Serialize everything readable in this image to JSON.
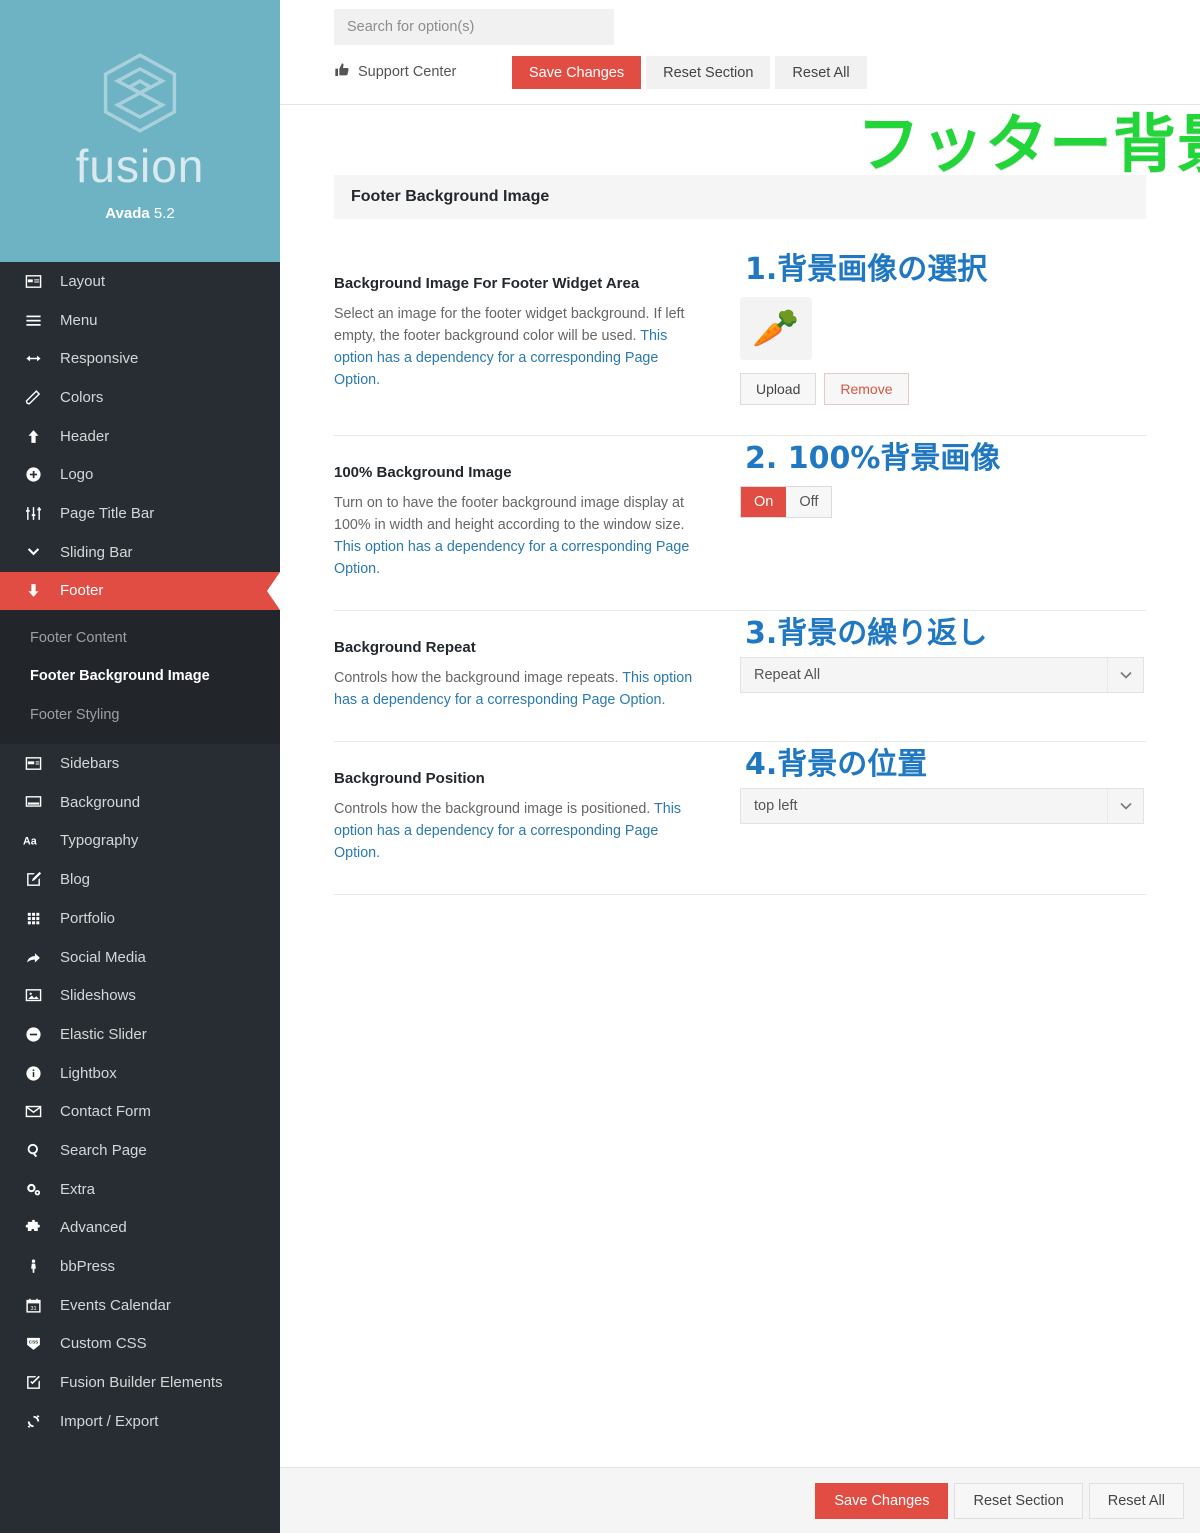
{
  "brand": {
    "logo_icon": "fusion-hex-logo-icon",
    "wordmark": "fusion",
    "product": "Avada",
    "version": "5.2"
  },
  "topbar": {
    "search_placeholder": "Search for option(s)",
    "search_value": "",
    "support_icon": "thumbs-up-icon",
    "support_label": "Support Center",
    "save_label": "Save Changes",
    "reset_section_label": "Reset Section",
    "reset_all_label": "Reset All"
  },
  "sidebar": {
    "items": [
      {
        "label": "Layout",
        "icon": "layout-icon"
      },
      {
        "label": "Menu",
        "icon": "hamburger-menu-icon"
      },
      {
        "label": "Responsive",
        "icon": "arrows-horizontal-icon"
      },
      {
        "label": "Colors",
        "icon": "paint-brush-icon"
      },
      {
        "label": "Header",
        "icon": "arrow-up-icon"
      },
      {
        "label": "Logo",
        "icon": "plus-circle-icon"
      },
      {
        "label": "Page Title Bar",
        "icon": "sliders-icon"
      },
      {
        "label": "Sliding Bar",
        "icon": "chevron-down-icon"
      },
      {
        "label": "Footer",
        "icon": "arrow-down-icon",
        "active": true
      },
      {
        "label": "Sidebars",
        "icon": "sidebars-icon"
      },
      {
        "label": "Background",
        "icon": "background-icon"
      },
      {
        "label": "Typography",
        "icon": "aa-typography-icon"
      },
      {
        "label": "Blog",
        "icon": "pencil-square-icon"
      },
      {
        "label": "Portfolio",
        "icon": "grid-dots-icon"
      },
      {
        "label": "Social Media",
        "icon": "share-arrow-icon"
      },
      {
        "label": "Slideshows",
        "icon": "image-icon"
      },
      {
        "label": "Elastic Slider",
        "icon": "minus-circle-icon"
      },
      {
        "label": "Lightbox",
        "icon": "info-circle-icon"
      },
      {
        "label": "Contact Form",
        "icon": "envelope-icon"
      },
      {
        "label": "Search Page",
        "icon": "search-icon"
      },
      {
        "label": "Extra",
        "icon": "gears-icon"
      },
      {
        "label": "Advanced",
        "icon": "puzzle-piece-icon"
      },
      {
        "label": "bbPress",
        "icon": "person-icon"
      },
      {
        "label": "Events Calendar",
        "icon": "calendar-icon"
      },
      {
        "label": "Custom CSS",
        "icon": "css-badge-icon"
      },
      {
        "label": "Fusion Builder Elements",
        "icon": "checkbox-edit-icon"
      },
      {
        "label": "Import / Export",
        "icon": "refresh-sync-icon"
      }
    ],
    "subitems": [
      {
        "label": "Footer Content",
        "current": false
      },
      {
        "label": "Footer Background Image",
        "current": true
      },
      {
        "label": "Footer Styling",
        "current": false
      }
    ]
  },
  "section": {
    "title": "Footer Background Image",
    "annotation_green": "フッター背景画像"
  },
  "options": [
    {
      "title": "Background Image For Footer Widget Area",
      "desc_plain": "Select an image for the footer widget background. If left empty, the footer background color will be used. ",
      "desc_link": "This option has a dependency for a corresponding Page Option.",
      "annotation": "1.背景画像の選択",
      "control": "image-upload",
      "thumbnail_icon": "carrot-emoji",
      "thumbnail_glyph": "🥕",
      "upload_label": "Upload",
      "remove_label": "Remove"
    },
    {
      "title": "100% Background Image",
      "desc_plain": "Turn on to have the footer background image display at 100% in width and height according to the window size. ",
      "desc_link": "This option has a dependency for a corresponding Page Option.",
      "annotation": "2. 100%背景画像",
      "control": "toggle",
      "on_label": "On",
      "off_label": "Off",
      "value": "On"
    },
    {
      "title": "Background Repeat",
      "desc_plain": "Controls how the background image repeats. ",
      "desc_link": "This option has a dependency for a corresponding Page Option.",
      "annotation": "3.背景の繰り返し",
      "control": "select",
      "value": "Repeat All"
    },
    {
      "title": "Background Position",
      "desc_plain": "Controls how the background image is positioned. ",
      "desc_link": "This option has a dependency for a corresponding Page Option.",
      "annotation": "4.背景の位置",
      "control": "select",
      "value": "top left"
    }
  ],
  "bottombar": {
    "save_label": "Save Changes",
    "reset_section_label": "Reset Section",
    "reset_all_label": "Reset All"
  },
  "colors": {
    "sidebar_bg": "#282d33",
    "sidebar_sub_bg": "#22262b",
    "brand_bg": "#6db3c4",
    "accent_red": "#e14d43",
    "link_blue": "#2a7ab0",
    "annotation_blue": "#1f78c1",
    "annotation_green": "#22d63a"
  }
}
